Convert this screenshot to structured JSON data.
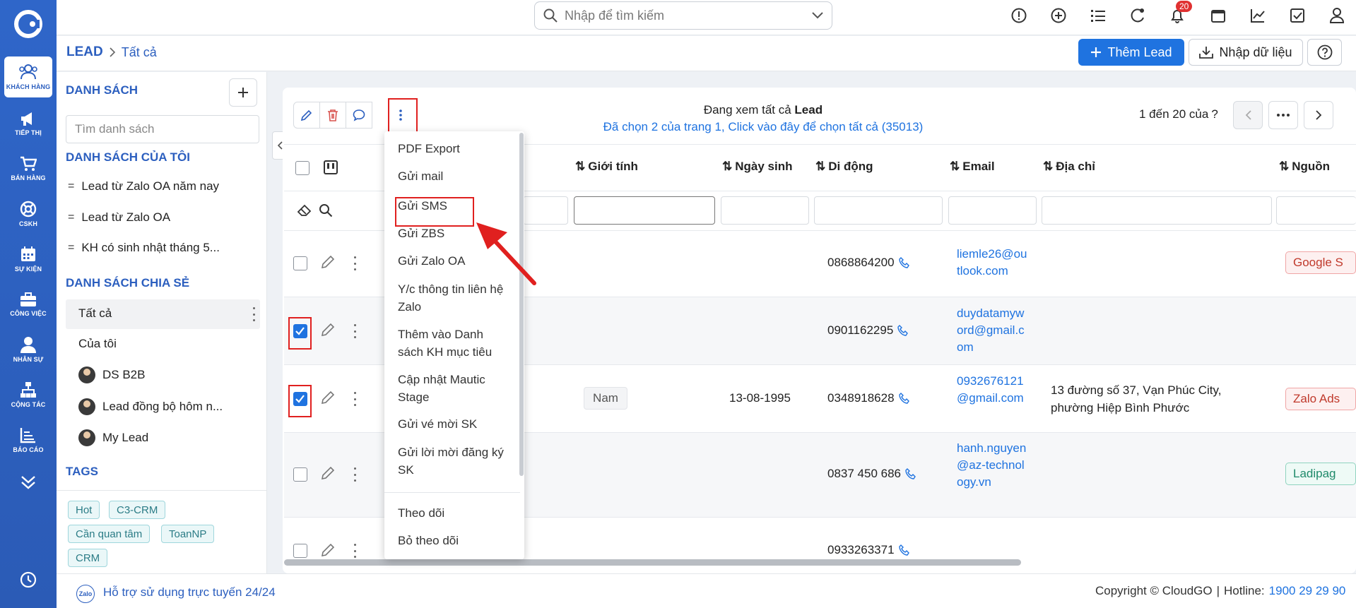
{
  "sidebar": {
    "items": [
      {
        "label": "KHÁCH HÀNG",
        "icon": "users-icon"
      },
      {
        "label": "TIẾP THỊ",
        "icon": "megaphone-icon"
      },
      {
        "label": "BÁN HÀNG",
        "icon": "cart-icon"
      },
      {
        "label": "CSKH",
        "icon": "lifebuoy-icon"
      },
      {
        "label": "SỰ KIỆN",
        "icon": "calendar-icon"
      },
      {
        "label": "CÔNG VIỆC",
        "icon": "briefcase-icon"
      },
      {
        "label": "NHÂN SỰ",
        "icon": "person-icon"
      },
      {
        "label": "CỘNG TÁC",
        "icon": "org-chart-icon"
      },
      {
        "label": "BÁO CÁO",
        "icon": "report-icon"
      }
    ]
  },
  "topbar": {
    "search_placeholder": "Nhập để tìm kiếm",
    "notification_count": "20"
  },
  "breadcrumb": {
    "root": "LEAD",
    "current": "Tất cả"
  },
  "actions": {
    "add_lead": "Thêm Lead",
    "import": "Nhập dữ liệu"
  },
  "leftpanel": {
    "title": "DANH SÁCH",
    "search_placeholder": "Tìm danh sách",
    "my_lists_title": "DANH SÁCH CỦA TÔI",
    "my_lists": [
      "Lead từ Zalo OA năm nay",
      "Lead từ Zalo OA",
      "KH có sinh nhật tháng 5..."
    ],
    "shared_title": "DANH SÁCH CHIA SẺ",
    "shared": [
      "Tất cả",
      "Của tôi",
      "DS B2B",
      "Lead đồng bộ hôm n...",
      "My Lead"
    ],
    "tags_title": "TAGS",
    "tags": [
      "Hot",
      "C3-CRM",
      "Cần quan tâm",
      "ToanNP",
      "CRM"
    ]
  },
  "list_info": {
    "line1_prefix": "Đang xem tất cả",
    "line1_bold": "Lead",
    "line2": "Đã chọn 2 của trang 1, Click vào đây để chọn tất cả (35013)"
  },
  "pager": {
    "text": "1 đến 20 của",
    "unknown": "?"
  },
  "columns": [
    "Giới tính",
    "Ngày sinh",
    "Di động",
    "Email",
    "Địa chỉ",
    "Nguồn"
  ],
  "rows": [
    {
      "checked": false,
      "gender": "",
      "birthday": "",
      "mobile": "0868864200",
      "email": "liemle26@outlook.com",
      "address": "",
      "source": "Google S"
    },
    {
      "checked": true,
      "gender": "",
      "birthday": "",
      "mobile": "0901162295",
      "email": "duydatamyword@gmail.com",
      "address": "",
      "source": ""
    },
    {
      "checked": true,
      "gender": "Nam",
      "birthday": "13-08-1995",
      "mobile": "0348918628",
      "email": "0932676121@gmail.com",
      "address": "13 đường số 37, Vạn Phúc City, phường Hiệp Bình Phước",
      "source": "Zalo Ads"
    },
    {
      "checked": false,
      "gender": "",
      "birthday": "",
      "mobile": "0837 450 686",
      "email": "hanh.nguyen@az-technology.vn",
      "address": "",
      "source": "Ladipag"
    },
    {
      "checked": false,
      "gender": "",
      "birthday": "",
      "mobile": "0933263371",
      "email": "",
      "address": "",
      "source": ""
    }
  ],
  "dropdown": {
    "items": [
      "PDF Export",
      "Gửi mail",
      "Gửi SMS",
      "Gửi ZBS",
      "Gửi Zalo OA",
      "Y/c thông tin liên hệ Zalo",
      "Thêm vào Danh sách KH mục tiêu",
      "Cập nhật Mautic Stage",
      "Gửi vé mời SK",
      "Gửi lời mời đăng ký SK"
    ],
    "items2": [
      "Theo dõi",
      "Bỏ theo dõi"
    ]
  },
  "footer": {
    "support": "Hỗ trợ sử dụng trực tuyến 24/24",
    "zalo": "Zalo",
    "copyright": "Copyright © CloudGO",
    "hotline_label": "Hotline:",
    "hotline": "1900 29 29 90"
  },
  "colors": {
    "primary": "#1f73e0",
    "sidebar": "#2c5fbf",
    "highlight": "#e0201f"
  }
}
